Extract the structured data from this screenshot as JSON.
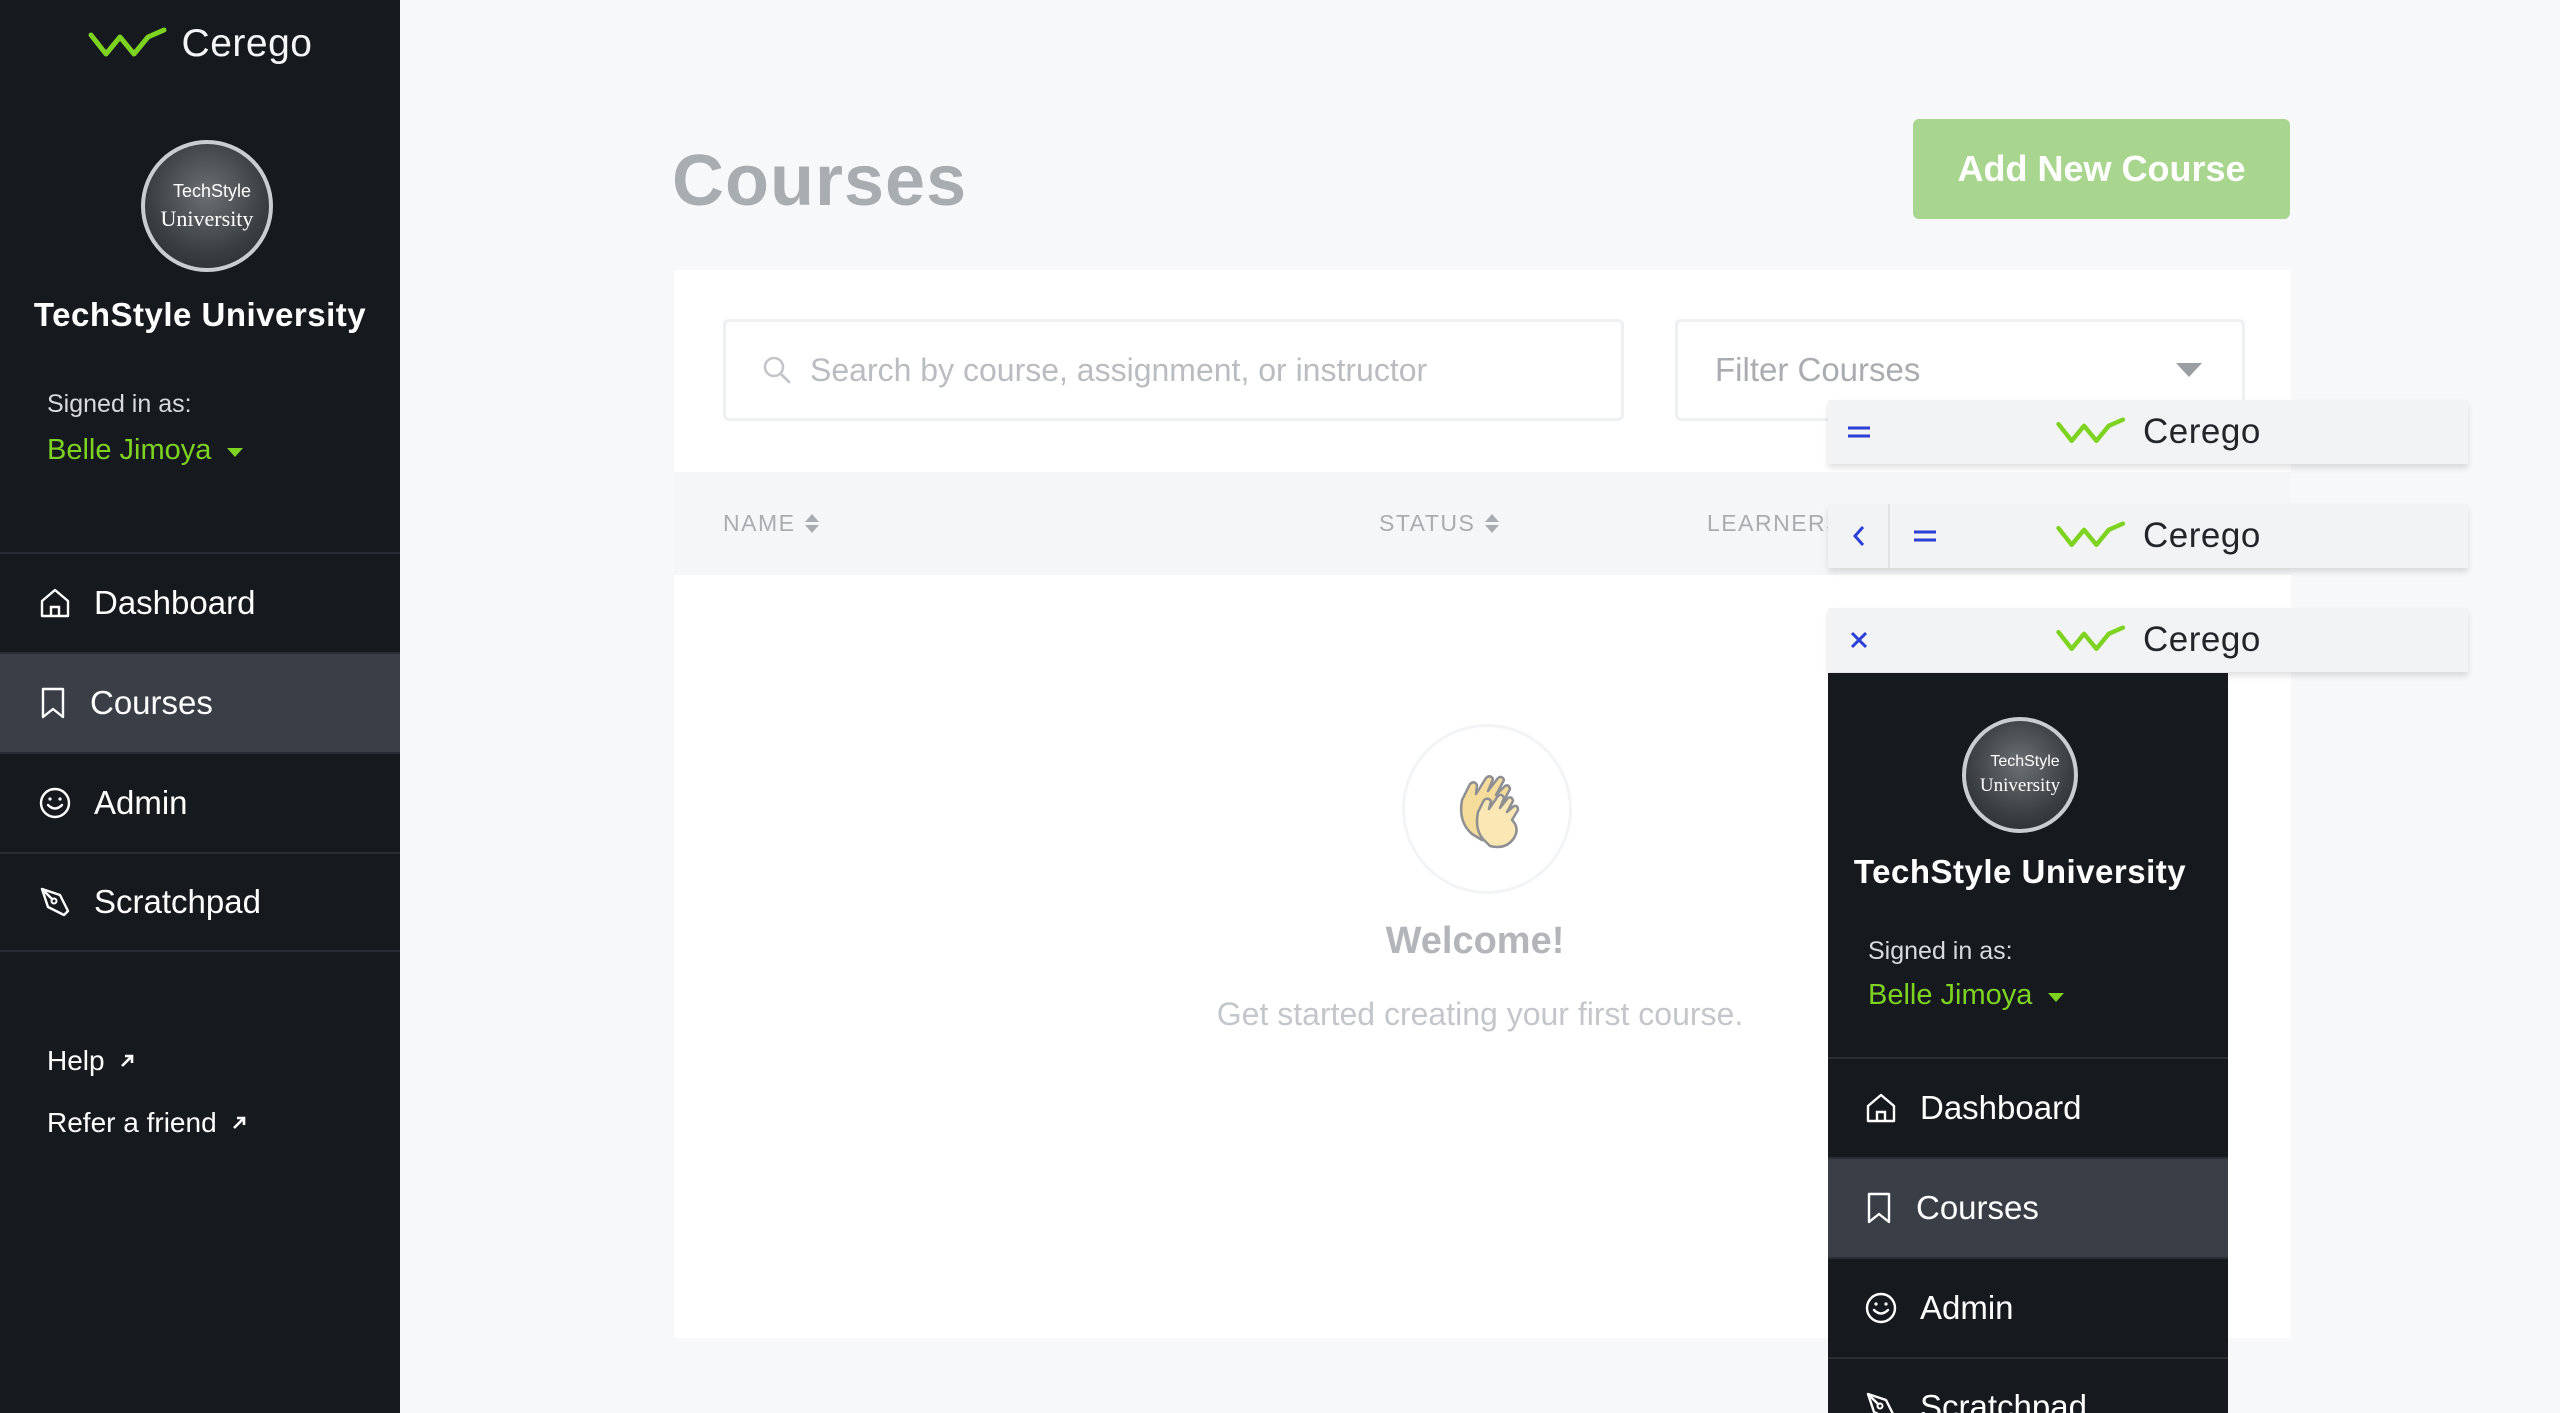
{
  "sidebar": {
    "brand": "Cerego",
    "org_logo": {
      "line1": "TechStyle",
      "line2": "University"
    },
    "org_name": "TechStyle University",
    "signed_in_label": "Signed in as:",
    "user_name": "Belle Jimoya",
    "nav": [
      {
        "label": "Dashboard",
        "icon": "home-icon"
      },
      {
        "label": "Courses",
        "icon": "bookmark-icon",
        "active": true
      },
      {
        "label": "Admin",
        "icon": "smiley-icon"
      },
      {
        "label": "Scratchpad",
        "icon": "pen-icon"
      }
    ],
    "links": [
      {
        "label": "Help",
        "icon": "external-link-icon"
      },
      {
        "label": "Refer a friend",
        "icon": "external-link-icon"
      }
    ]
  },
  "main": {
    "title": "Courses",
    "add_button": "Add New Course",
    "search_placeholder": "Search by course, assignment, or instructor",
    "filter_placeholder": "Filter Courses",
    "columns": [
      "NAME",
      "STATUS",
      "LEARNERS"
    ],
    "empty": {
      "icon": "clapping-hands-icon",
      "title": "Welcome!",
      "subtitle": "Get started creating your first course."
    }
  },
  "mobile": {
    "brand": "Cerego",
    "bars": [
      {
        "buttons": [
          "menu-icon"
        ]
      },
      {
        "buttons": [
          "back-icon",
          "menu-icon"
        ]
      },
      {
        "buttons": [
          "close-icon"
        ]
      }
    ],
    "org_logo": {
      "line1": "TechStyle",
      "line2": "University"
    },
    "org_name": "TechStyle University",
    "signed_in_label": "Signed in as:",
    "user_name": "Belle Jimoya",
    "nav": [
      {
        "label": "Dashboard"
      },
      {
        "label": "Courses",
        "active": true
      },
      {
        "label": "Admin"
      },
      {
        "label": "Scratchpad"
      }
    ]
  },
  "colors": {
    "sidebar_bg": "#16191e",
    "accent_green": "#7ed321",
    "button_green": "#a9d68f",
    "active_nav": "#3a3f47",
    "mobile_icon_blue": "#2b3fd6"
  }
}
